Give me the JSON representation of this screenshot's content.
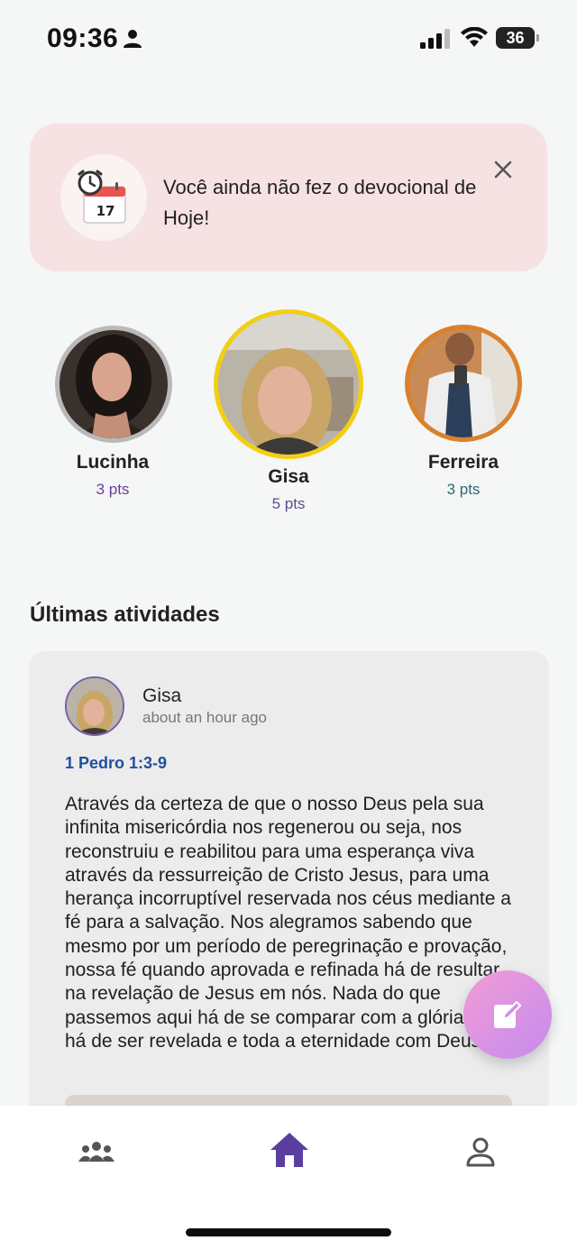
{
  "status_bar": {
    "time": "09:36",
    "battery": "36"
  },
  "banner": {
    "message": "Você ainda não fez o devocional de Hoje!",
    "calendar_day": "17"
  },
  "ranking": [
    {
      "name": "Lucinha",
      "points": "3 pts",
      "ring_color": "#b9b9b9",
      "pts_color": "#6b3f9a"
    },
    {
      "name": "Gisa",
      "points": "5 pts",
      "ring_color": "#f2cf12",
      "pts_color": "#5a4e8e"
    },
    {
      "name": "Ferreira",
      "points": "3 pts",
      "ring_color": "#d9822b",
      "pts_color": "#2d6a72"
    }
  ],
  "section_title": "Últimas atividades",
  "activity": {
    "user": "Gisa",
    "time": "about an hour ago",
    "reference": "1 Pedro 1:3-9",
    "text": "Através da certeza de que o nosso Deus pela sua infinita misericórdia nos regenerou ou seja, nos reconstruiu e reabilitou para uma esperança viva através da ressurreição de  Cristo Jesus, para uma herança incorruptível reservada nos céus mediante a fé para a salvação. Nos alegramos sabendo que mesmo por um período de peregrinação e provação, nossa fé quando aprovada e refinada há de resultar na revelação de Jesus em nós. Nada do que passemos aqui há de se comparar com a glória que há de ser revelada e toda a eternidade com Deus."
  },
  "nav": {
    "items": [
      "group-icon",
      "home-icon",
      "profile-icon"
    ],
    "active_color": "#5b3fa0",
    "inactive_color": "#555555"
  },
  "colors": {
    "accent": "#5b3fa0",
    "banner_bg": "#f6e1e3",
    "reference": "#1f4fa0"
  }
}
